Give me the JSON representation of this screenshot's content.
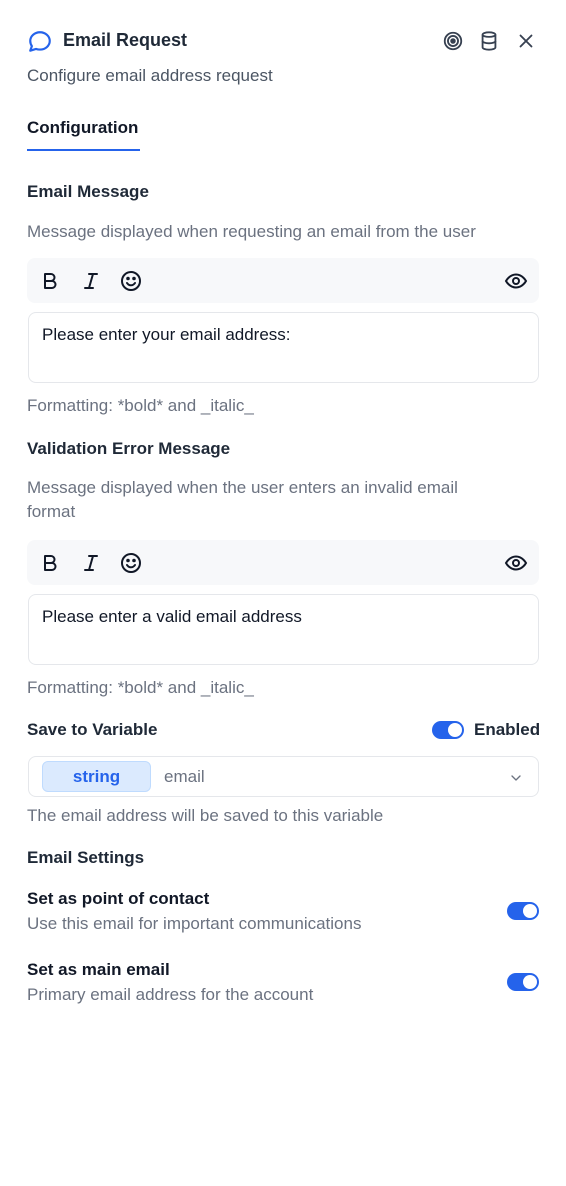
{
  "header": {
    "title": "Email Request",
    "subtitle": "Configure email address request",
    "icons": [
      "chat-bubble-icon",
      "target-icon",
      "database-icon",
      "close-icon"
    ]
  },
  "tabs": [
    {
      "label": "Configuration",
      "active": true
    }
  ],
  "email_message": {
    "label": "Email Message",
    "description": "Message displayed when requesting an email from the user",
    "toolbar": [
      "bold-icon",
      "italic-icon",
      "emoji-icon",
      "eye-icon"
    ],
    "value": "Please enter your email address:",
    "hint": "Formatting: *bold* and _italic_"
  },
  "validation_message": {
    "label": "Validation Error Message",
    "description_line1": "Message displayed when the user enters an invalid email",
    "description_line2": "format",
    "value": "Please enter a valid email address",
    "hint": "Formatting: *bold* and _italic_"
  },
  "save_variable": {
    "label": "Save to Variable",
    "toggle_label": "Enabled",
    "enabled": true,
    "type_chip": "string",
    "variable": "email",
    "hint": "The email address will be saved to this variable"
  },
  "email_settings": {
    "label": "Email Settings",
    "items": [
      {
        "title": "Set as point of contact",
        "description": "Use this email for important communications",
        "enabled": true
      },
      {
        "title": "Set as main email",
        "description": "Primary email address for the account",
        "enabled": true
      }
    ]
  },
  "colors": {
    "accent": "#2563eb",
    "muted": "#6b7280"
  }
}
